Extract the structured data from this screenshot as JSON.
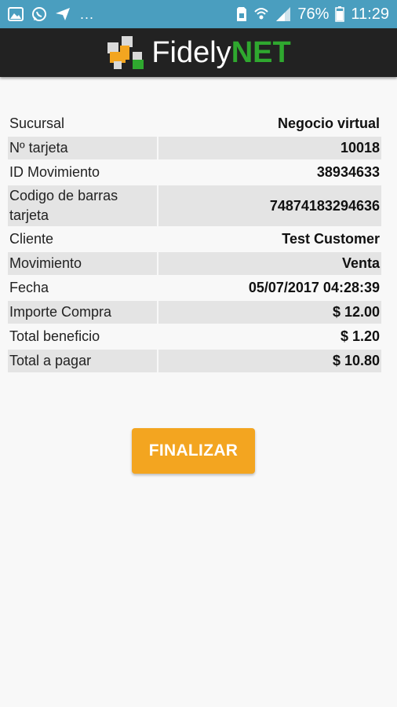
{
  "status_bar": {
    "battery_percent": "76%",
    "time": "11:29",
    "more_indicator": "...",
    "icons": [
      "image-icon",
      "whatsapp-icon",
      "send-icon",
      "sim-icon",
      "wifi-icon",
      "signal-icon",
      "battery-icon"
    ]
  },
  "header": {
    "logo_text_part1": "Fidely",
    "logo_text_part2": "NET",
    "colors": {
      "background": "#222222",
      "net": "#2fa82f",
      "logo_orange": "#f3a520"
    }
  },
  "details": {
    "rows": [
      {
        "label": "Sucursal",
        "value": "Negocio virtual"
      },
      {
        "label": "Nº tarjeta",
        "value": "10018"
      },
      {
        "label": "ID Movimiento",
        "value": "38934633"
      },
      {
        "label": "Codigo de barras tarjeta",
        "value": "74874183294636"
      },
      {
        "label": "Cliente",
        "value": "Test Customer"
      },
      {
        "label": "Movimiento",
        "value": "Venta"
      },
      {
        "label": "Fecha",
        "value": "05/07/2017 04:28:39"
      },
      {
        "label": "Importe Compra",
        "value": "$ 12.00"
      },
      {
        "label": "Total beneficio",
        "value": "$ 1.20"
      },
      {
        "label": "Total a pagar",
        "value": "$ 10.80"
      }
    ]
  },
  "actions": {
    "finalize_label": "FINALIZAR",
    "finalize_color": "#f3a520"
  }
}
